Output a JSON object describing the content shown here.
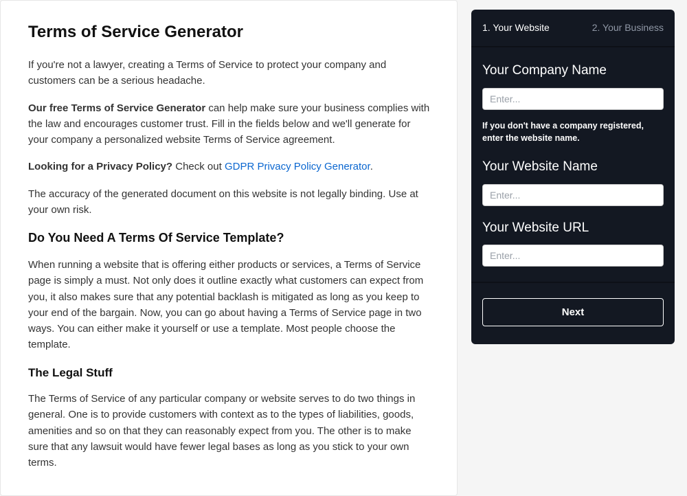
{
  "content": {
    "title": "Terms of Service Generator",
    "p1": "If you're not a lawyer, creating a Terms of Service to protect your company and customers can be a serious headache.",
    "p2_bold": "Our free Terms of Service Generator",
    "p2_rest": " can help make sure your business complies with the law and encourages customer trust. Fill in the fields below and we'll generate for your company a personalized website Terms of Service agreement.",
    "p3_bold": "Looking for a Privacy Policy?",
    "p3_mid": " Check out ",
    "p3_link": "GDPR Privacy Policy Generator",
    "p3_end": ".",
    "p4": "The accuracy of the generated document on this website is not legally binding. Use at your own risk.",
    "h2_a": "Do You Need A Terms Of Service Template?",
    "p5": "When running a website that is offering either products or services, a Terms of Service page is simply a must. Not only does it outline exactly what customers can expect from you, it also makes sure that any potential backlash is mitigated as long as you keep to your end of the bargain. Now, you can go about having a Terms of Service page in two ways. You can either make it yourself or use a template. Most people choose the template.",
    "h3_b": "The Legal Stuff",
    "p6": "The Terms of Service of any particular company or website serves to do two things in general. One is to provide customers with context as to the types of liabilities, goods, amenities and so on that they can reasonably expect from you. The other is to make sure that any lawsuit would have fewer legal bases as long as you stick to your own terms."
  },
  "form": {
    "tabs": {
      "a": "1. Your Website",
      "b": "2. Your Business"
    },
    "company": {
      "label": "Your Company Name",
      "placeholder": "Enter...",
      "hint": "If you don't have a company registered, enter the website name."
    },
    "website_name": {
      "label": "Your Website Name",
      "placeholder": "Enter..."
    },
    "website_url": {
      "label": "Your Website URL",
      "placeholder": "Enter..."
    },
    "next_label": "Next"
  }
}
